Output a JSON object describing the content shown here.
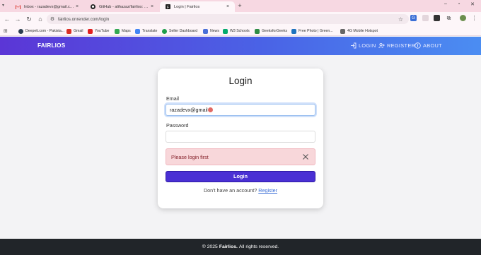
{
  "browser": {
    "tabs": [
      {
        "title": "Inbox - razadevx@gmail.com - Gmail",
        "icon": "gmail-icon"
      },
      {
        "title": "GitHub - alihazaz/fairlios: Fairlios",
        "icon": "github-icon"
      },
      {
        "title": "Login | Fairlios",
        "icon": "fairlios-favicon",
        "active": true
      }
    ],
    "new_tab": "+",
    "url": "fairlios.onrender.com/login",
    "bookmarks": [
      {
        "label": "Deepeti.com - Pakista...",
        "color": "#2c3e50"
      },
      {
        "label": "Gmail",
        "color": "#d93025"
      },
      {
        "label": "YouTube",
        "color": "#e02020"
      },
      {
        "label": "Maps",
        "color": "#34a853"
      },
      {
        "label": "Translate",
        "color": "#4285f4"
      },
      {
        "label": "Seller Dashboard",
        "color": "#1e9e4a"
      },
      {
        "label": "News",
        "color": "#4a6fd8"
      },
      {
        "label": "W3 Schools",
        "color": "#04aa6d"
      },
      {
        "label": "GeeksforGeeks",
        "color": "#2f8d46"
      },
      {
        "label": "Free Photo | Green...",
        "color": "#1e73be"
      },
      {
        "label": "4G Mobile Hotspot",
        "color": "#666666"
      }
    ]
  },
  "site": {
    "brand": "FAIRLIOS",
    "nav": {
      "login": "LOGIN",
      "register": "REGISTER",
      "about": "ABOUT"
    }
  },
  "login": {
    "title": "Login",
    "email_label": "Email",
    "email_value": "razadevx@gmail",
    "password_label": "Password",
    "password_value": "",
    "alert": "Please login first",
    "submit": "Login",
    "register_prompt": "Don't have an account?",
    "register_link": "Register"
  },
  "footer": {
    "prefix": "© 2025",
    "brand": "Fairlios.",
    "suffix": "All rights reserved."
  },
  "colors": {
    "nav_gradient_start": "#5b36d6",
    "nav_gradient_end": "#4b8df2",
    "primary_button": "#4a30d4",
    "alert_bg": "#f8d7da",
    "alert_text": "#842029",
    "footer_bg": "#212529"
  }
}
